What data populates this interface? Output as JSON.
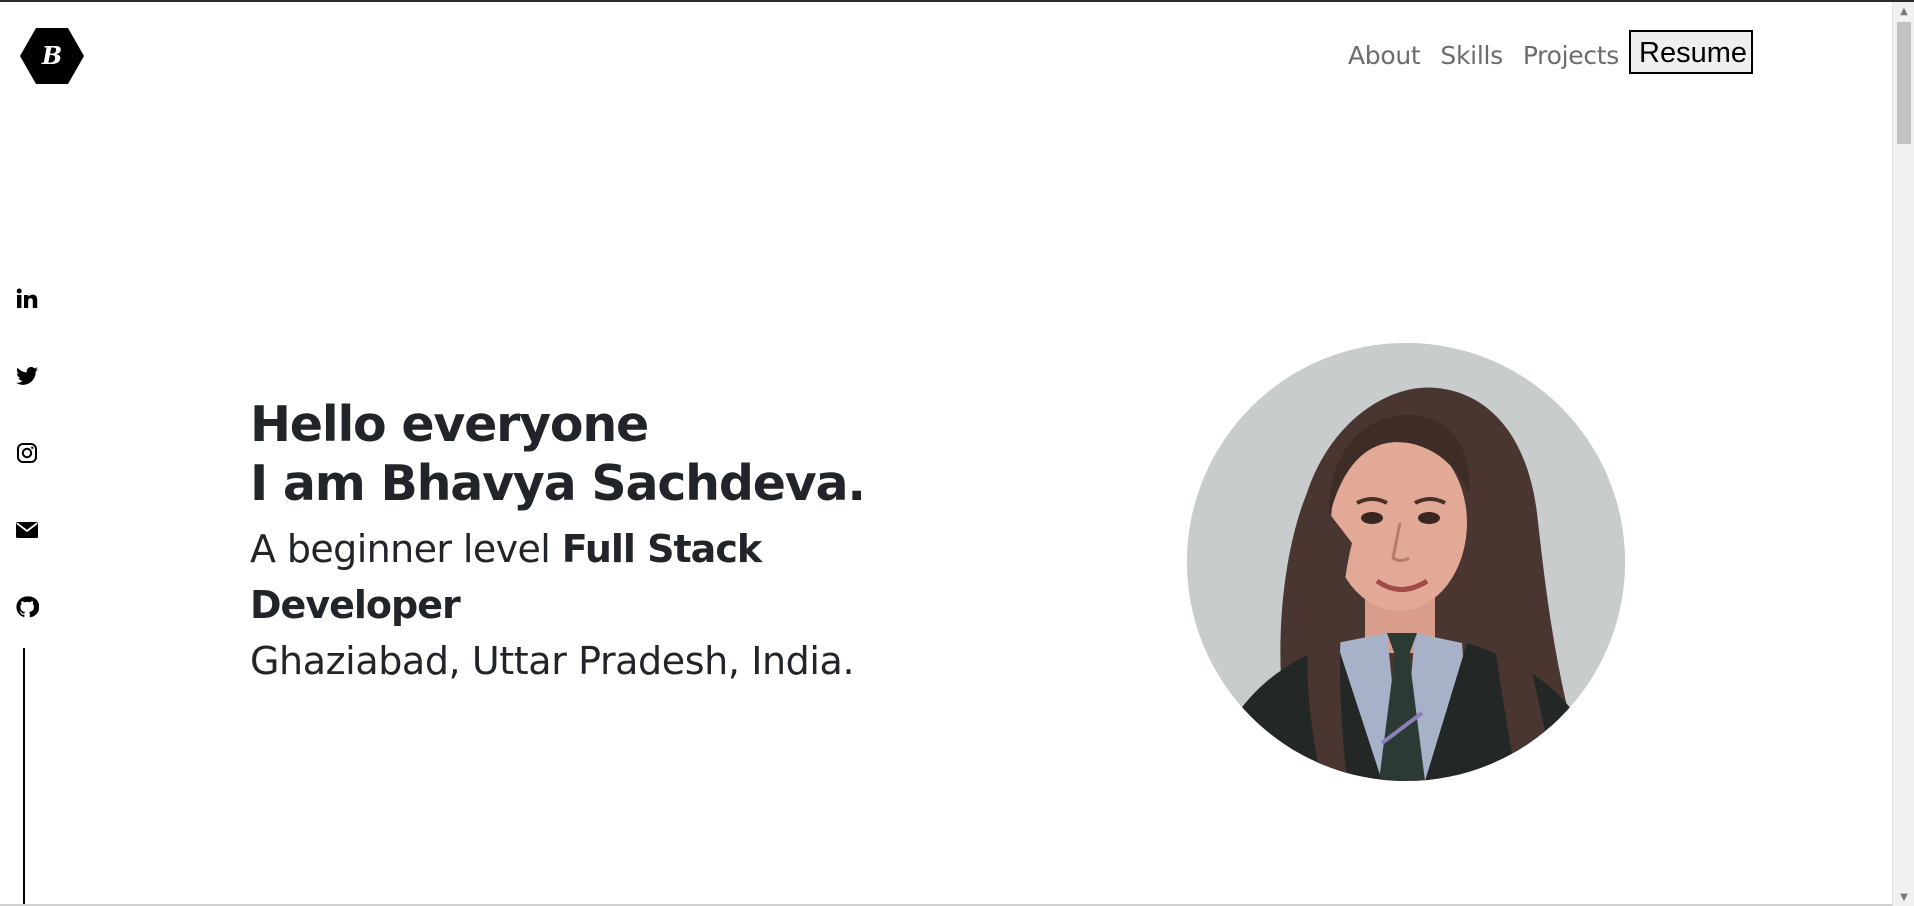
{
  "logo": {
    "letter": "B"
  },
  "nav": {
    "about": "About",
    "skills": "Skills",
    "projects": "Projects",
    "resume": "Resume"
  },
  "socials": [
    "linkedin-icon",
    "twitter-icon",
    "instagram-icon",
    "envelope-icon",
    "github-icon"
  ],
  "hero": {
    "greeting": "Hello everyone",
    "name_line": "I am Bhavya Sachdeva.",
    "tagline_prefix": "A beginner level ",
    "tagline_role": "Full Stack Developer",
    "location": "Ghaziabad, Uttar Pradesh, India."
  },
  "colors": {
    "text": "#212529",
    "nav_link": "#6c6c6c",
    "logo_bg": "#000000",
    "resume_bg": "#efefef"
  }
}
